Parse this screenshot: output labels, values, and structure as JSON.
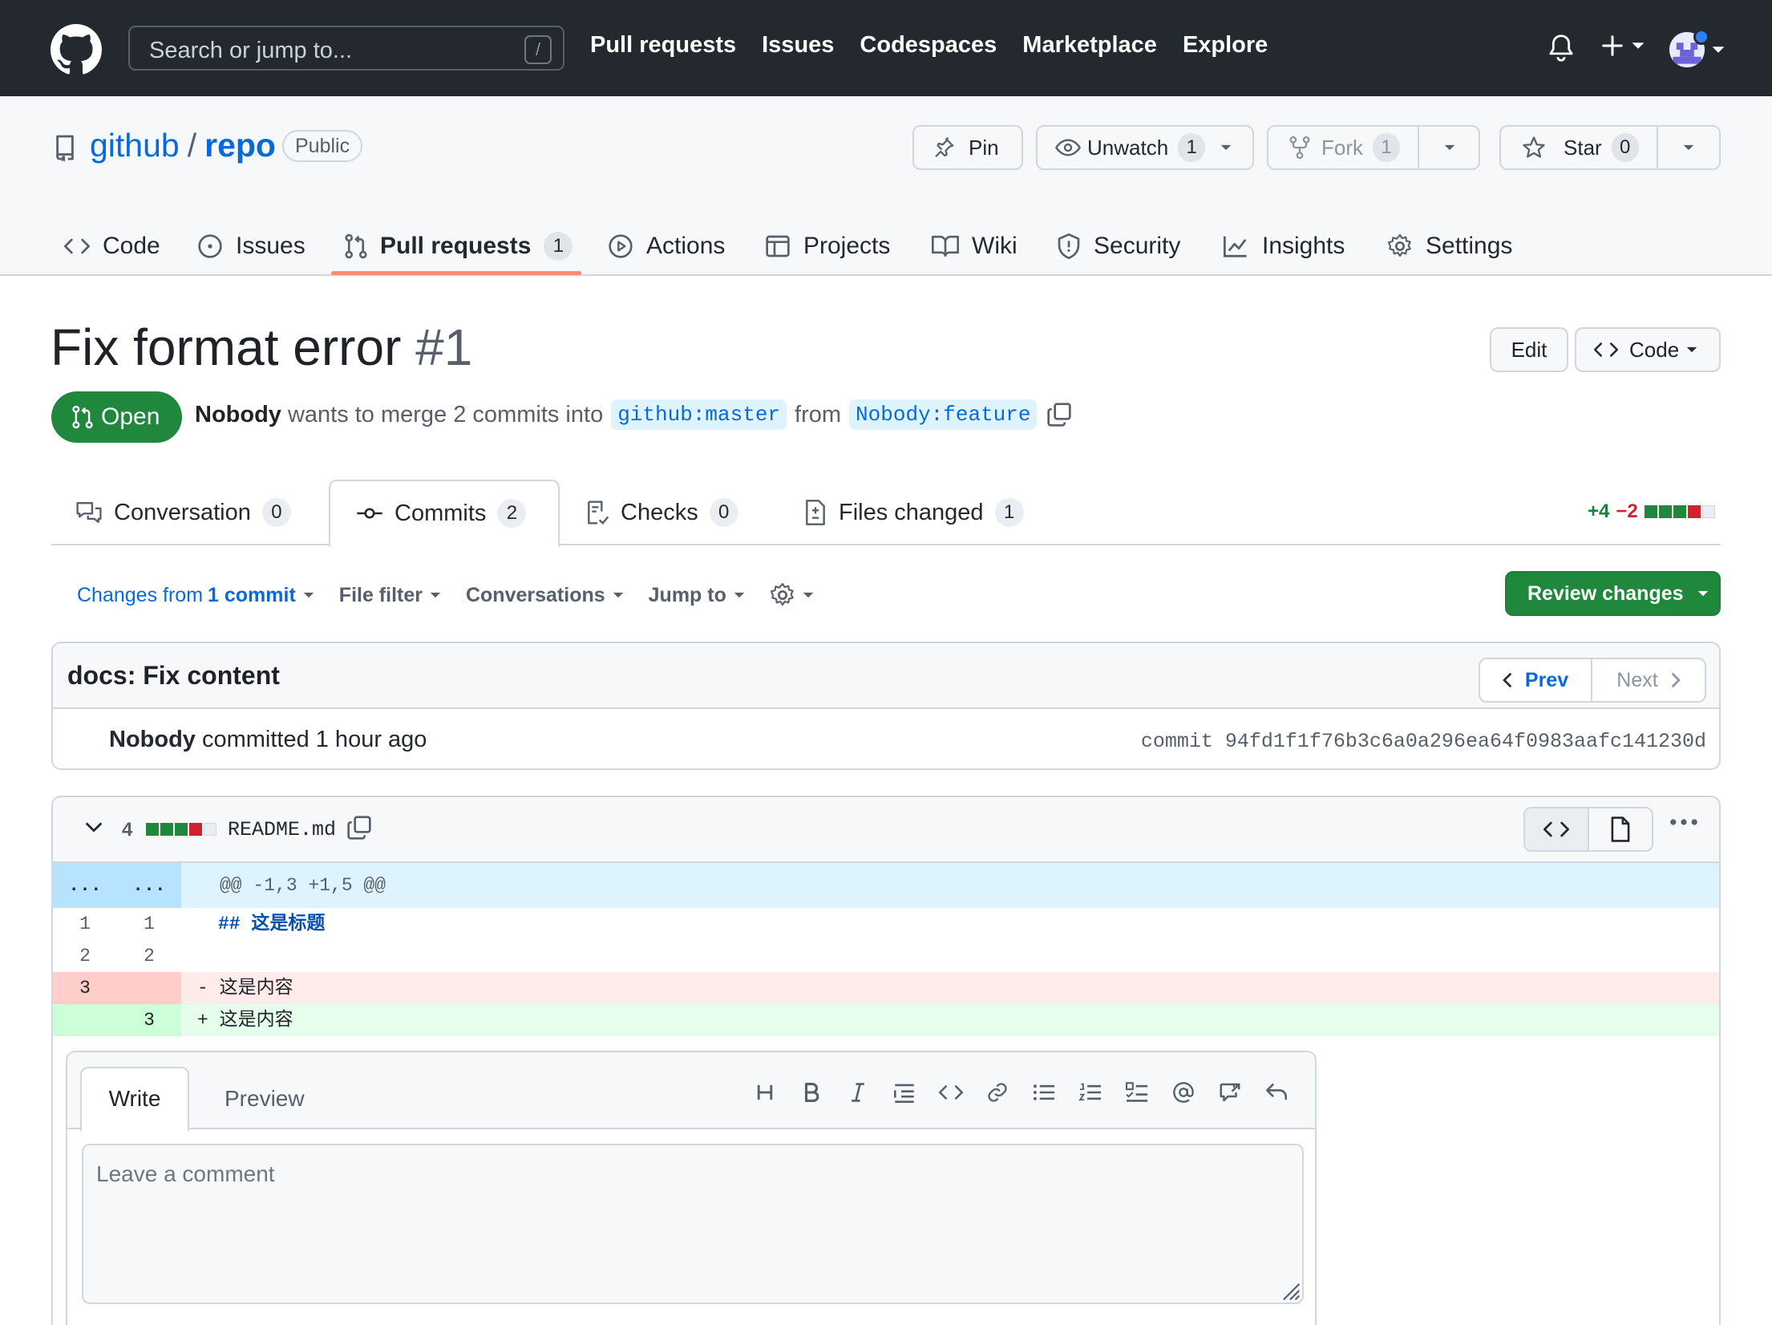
{
  "topnav": {
    "search_placeholder": "Search or jump to...",
    "search_key": "/",
    "links": [
      "Pull requests",
      "Issues",
      "Codespaces",
      "Marketplace",
      "Explore"
    ]
  },
  "repo": {
    "owner": "github",
    "separator": "/",
    "name": "repo",
    "visibility": "Public",
    "pin_label": "Pin",
    "watch_label": "Unwatch",
    "watch_count": "1",
    "fork_label": "Fork",
    "fork_count": "1",
    "star_label": "Star",
    "star_count": "0"
  },
  "repo_tabs": [
    {
      "label": "Code"
    },
    {
      "label": "Issues"
    },
    {
      "label": "Pull requests",
      "count": "1"
    },
    {
      "label": "Actions"
    },
    {
      "label": "Projects"
    },
    {
      "label": "Wiki"
    },
    {
      "label": "Security"
    },
    {
      "label": "Insights"
    },
    {
      "label": "Settings"
    }
  ],
  "pr": {
    "title": "Fix format error",
    "number": "#1",
    "edit_label": "Edit",
    "code_label": "Code",
    "state": "Open",
    "author": "Nobody",
    "merge_text": "wants to merge 2 commits into",
    "base_branch": "github:master",
    "from_text": "from",
    "head_branch": "Nobody:feature"
  },
  "pr_tabs": [
    {
      "label": "Conversation",
      "count": "0"
    },
    {
      "label": "Commits",
      "count": "2"
    },
    {
      "label": "Checks",
      "count": "0"
    },
    {
      "label": "Files changed",
      "count": "1"
    }
  ],
  "diffstat": {
    "additions": "+4",
    "deletions": "−2"
  },
  "toolbar": {
    "changes_from": "Changes from",
    "changes_commit": "1 commit",
    "file_filter": "File filter",
    "conversations": "Conversations",
    "jump_to": "Jump to",
    "review_button": "Review changes"
  },
  "commit": {
    "message": "docs: Fix content",
    "prev_label": "Prev",
    "next_label": "Next",
    "author": "Nobody",
    "action_time": "committed 1 hour ago",
    "sha_text": "commit 94fd1f1f76b3c6a0a296ea64f0983aafc141230d"
  },
  "file": {
    "change_count": "4",
    "name": "README.md"
  },
  "diff": {
    "hunk_marker_left": "...",
    "hunk_marker_right": "...",
    "hunk_header": "@@ -1,3 +1,5 @@",
    "lines": [
      {
        "old": "1",
        "new": "1",
        "text": "## 这是标题"
      },
      {
        "old": "2",
        "new": "2",
        "text": ""
      },
      {
        "old": "3",
        "new": "",
        "text": "- 这是内容"
      },
      {
        "old": "",
        "new": "3",
        "text": "+ 这是内容"
      }
    ]
  },
  "comment_form": {
    "write_tab": "Write",
    "preview_tab": "Preview",
    "placeholder": "Leave a comment"
  },
  "colors": {
    "nav_bg": "#24292f",
    "open_green": "#1f883d",
    "link_blue": "#0969da",
    "add_bg": "#e6ffec",
    "del_bg": "#ffebe9",
    "hunk_bg": "#ddf4ff",
    "tab_underline": "#fd8c73"
  }
}
